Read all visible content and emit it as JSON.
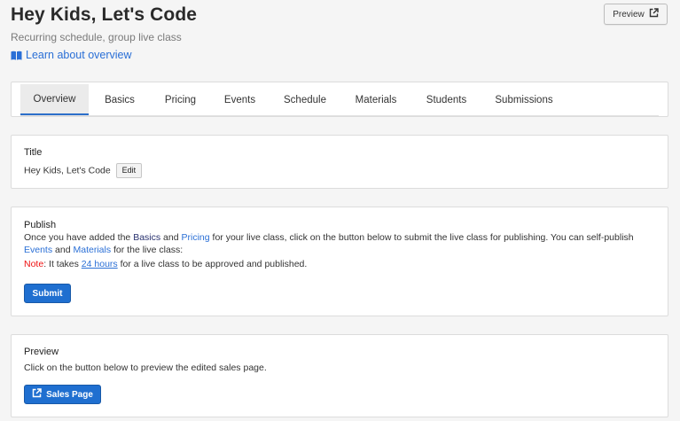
{
  "header": {
    "title": "Hey Kids, Let's Code",
    "subtitle": "Recurring schedule, group live class",
    "learn_link": "Learn about overview",
    "preview_label": "Preview"
  },
  "tabs": [
    {
      "label": "Overview",
      "active": true
    },
    {
      "label": "Basics",
      "active": false
    },
    {
      "label": "Pricing",
      "active": false
    },
    {
      "label": "Events",
      "active": false
    },
    {
      "label": "Schedule",
      "active": false
    },
    {
      "label": "Materials",
      "active": false
    },
    {
      "label": "Students",
      "active": false
    },
    {
      "label": "Submissions",
      "active": false
    }
  ],
  "title_card": {
    "heading": "Title",
    "value": "Hey Kids, Let's Code",
    "edit_label": "Edit"
  },
  "publish_card": {
    "heading": "Publish",
    "text_1": "Once you have added the",
    "basics": "Basics",
    "text_2": "and",
    "pricing": "Pricing",
    "text_3": "for your live class, click on the button below to submit the live class for publishing. You can self-publish",
    "events": "Events",
    "text_4": "and",
    "materials": "Materials",
    "text_5": "for the live class:",
    "note_label": "Note",
    "note_text_1": ": It takes",
    "note_link": "24 hours",
    "note_text_2": "for a live class to be approved and published.",
    "submit_label": "Submit"
  },
  "preview_card": {
    "heading": "Preview",
    "text": "Click on the button below to preview the edited sales page.",
    "button_label": "Sales Page"
  },
  "colors": {
    "accent": "#1f6fd0",
    "link": "#2a6fd6",
    "note": "#ee1111",
    "background": "#f5f5f5"
  },
  "icons": {
    "learn": "book-open-icon",
    "preview": "external-link-icon",
    "sales_page": "external-link-icon"
  }
}
